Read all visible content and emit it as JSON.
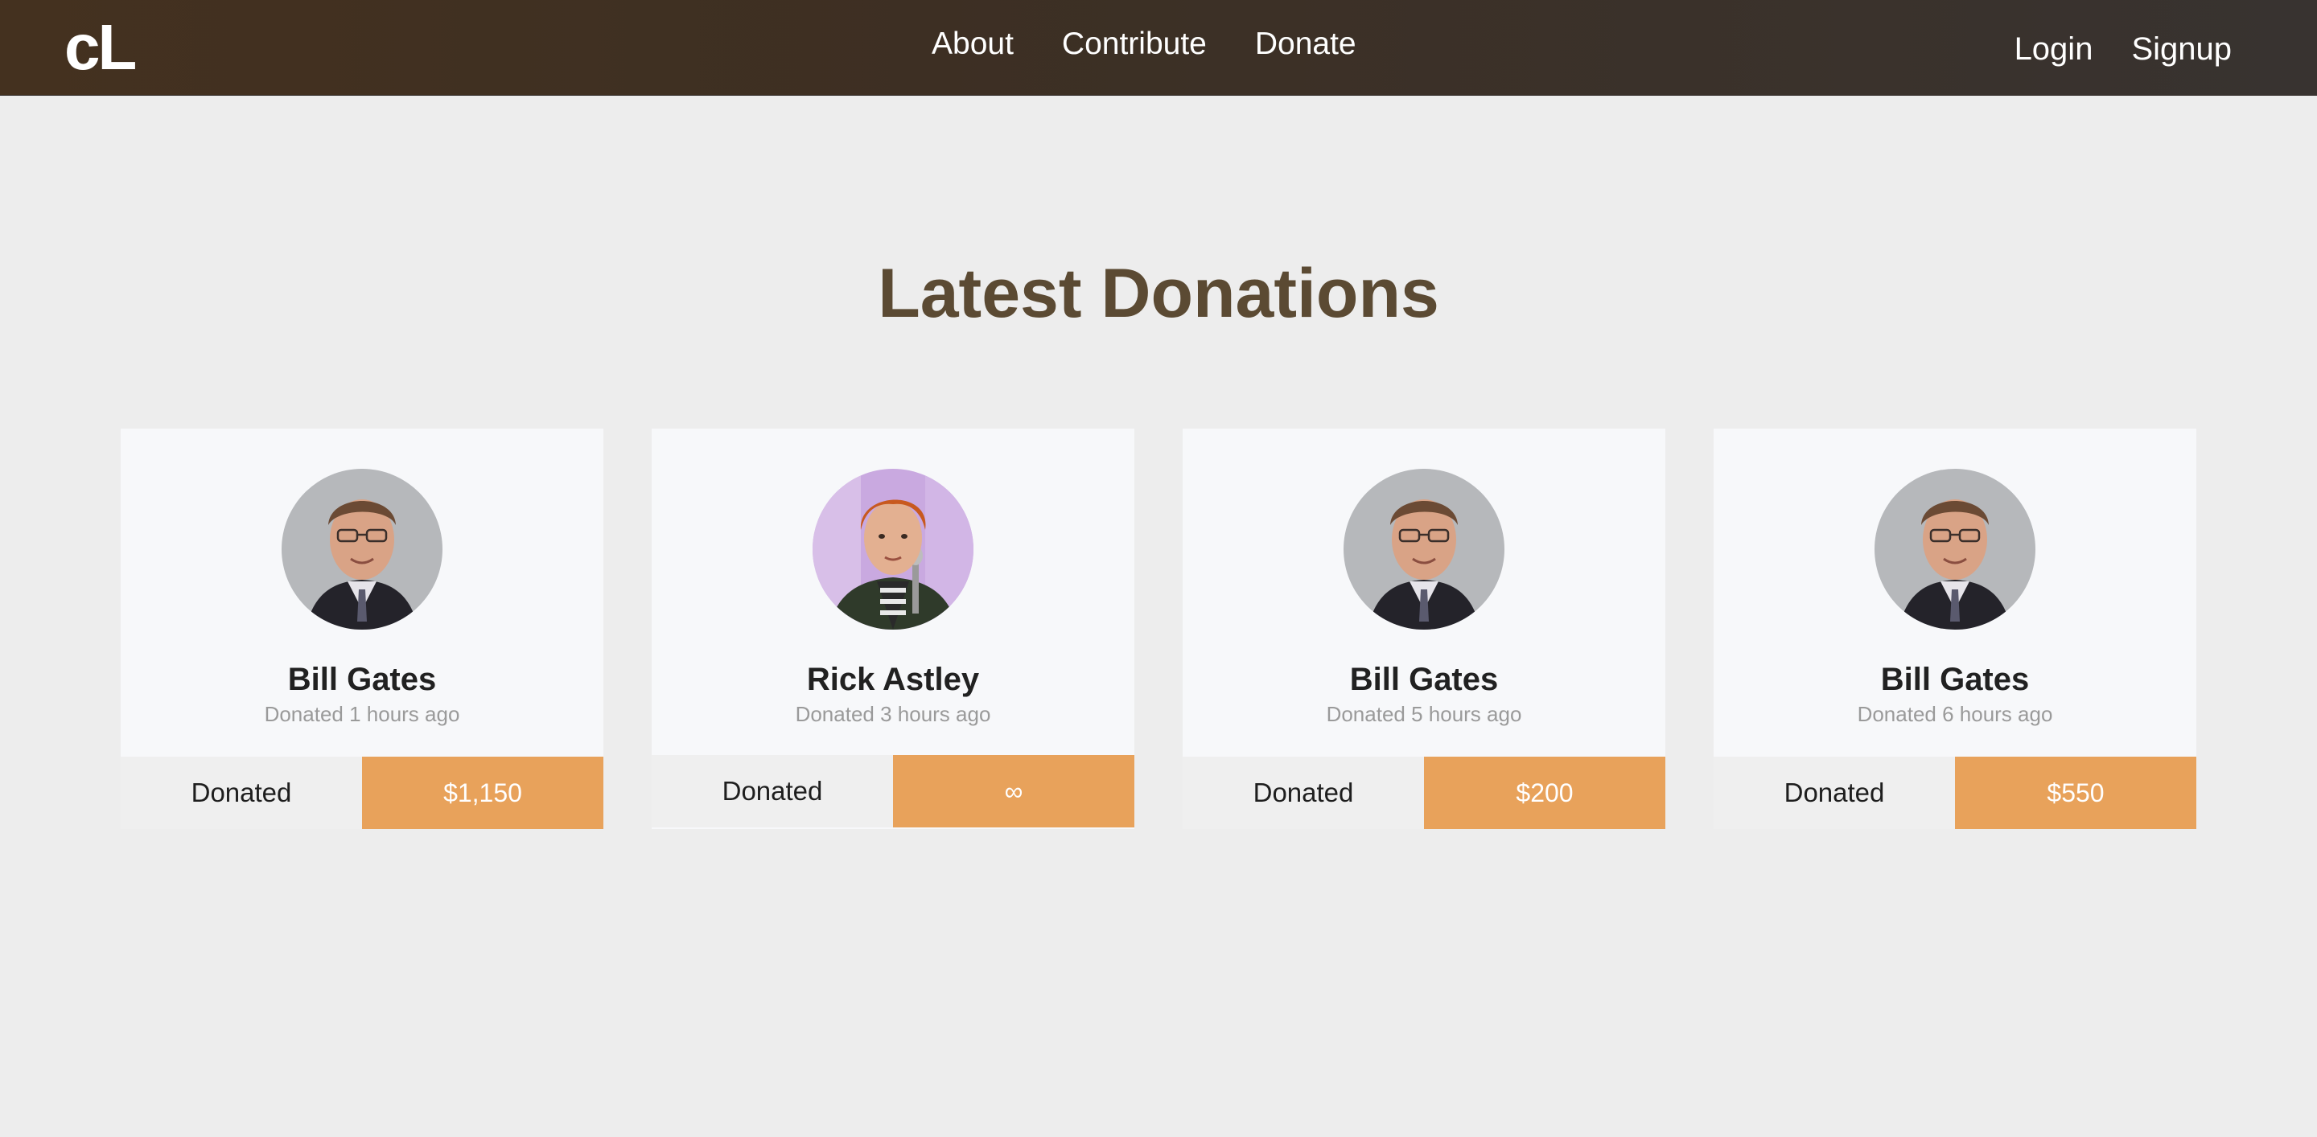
{
  "nav": {
    "brand": "cL",
    "links": [
      "About",
      "Contribute",
      "Donate"
    ],
    "auth": [
      "Login",
      "Signup"
    ],
    "background": "#3d2f23"
  },
  "main": {
    "title": "Latest Donations",
    "title_color": "#5b4a33",
    "accent_color": "#e8a25b",
    "donations": [
      {
        "name": "Bill Gates",
        "time": "Donated 1 hours ago",
        "label": "Donated",
        "amount": "$1,150",
        "avatar": "bill-gates-avatar"
      },
      {
        "name": "Rick Astley",
        "time": "Donated 3 hours ago",
        "label": "Donated",
        "amount": "∞",
        "avatar": "rick-astley-avatar"
      },
      {
        "name": "Bill Gates",
        "time": "Donated 5 hours ago",
        "label": "Donated",
        "amount": "$200",
        "avatar": "bill-gates-avatar"
      },
      {
        "name": "Bill Gates",
        "time": "Donated 6 hours ago",
        "label": "Donated",
        "amount": "$550",
        "avatar": "bill-gates-avatar"
      }
    ]
  }
}
